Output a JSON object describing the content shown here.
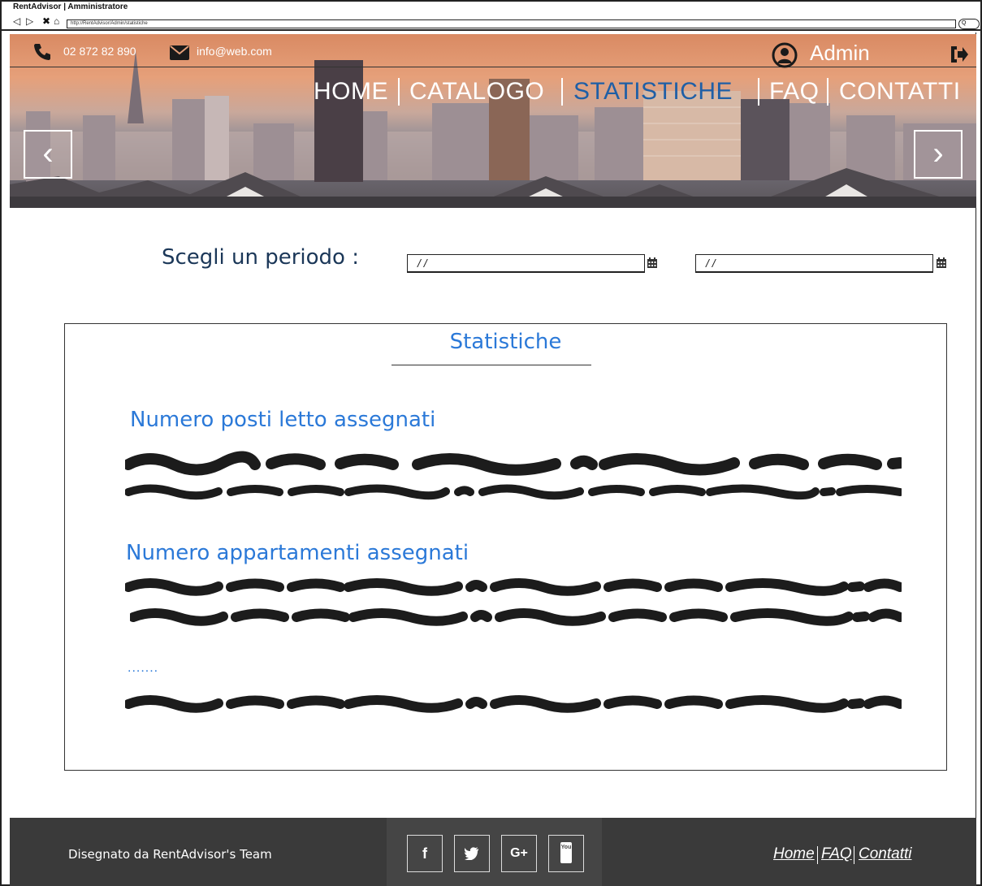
{
  "browser": {
    "window_title": "RentAdvisor | Amministratore",
    "url": "http://RentAdvisor/Admin/statistiche",
    "nav_back": "◁",
    "nav_forward": "▷",
    "nav_stop": "✖",
    "nav_home": "⌂",
    "search_glyph": "Q"
  },
  "header": {
    "phone": "02 872 82 890",
    "email": "info@web.com",
    "user_label": "Admin",
    "nav": [
      {
        "label": "HOME",
        "active": false
      },
      {
        "label": "CATALOGO",
        "active": false
      },
      {
        "label": "STATISTICHE",
        "active": true
      },
      {
        "label": "FAQ",
        "active": false
      },
      {
        "label": "CONTATTI",
        "active": false
      }
    ],
    "carousel_prev": "‹",
    "carousel_next": "›",
    "icons": {
      "phone": "phone-icon",
      "email": "envelope-icon",
      "user": "user-icon",
      "logout": "logout-icon",
      "calendar": "calendar-icon"
    }
  },
  "period": {
    "label": "Scegli un periodo :",
    "from_value": "/ /",
    "to_value": "/ /"
  },
  "stats": {
    "title": "Statistiche",
    "sections": [
      {
        "title": "Numero posti letto assegnati"
      },
      {
        "title": "Numero appartamenti assegnati"
      },
      {
        "title": "......."
      }
    ]
  },
  "footer": {
    "credit": "Disegnato da RentAdvisor's Team",
    "social": [
      {
        "name": "facebook",
        "glyph": "f"
      },
      {
        "name": "twitter",
        "glyph": "🐦"
      },
      {
        "name": "google-plus",
        "glyph": "G+"
      },
      {
        "name": "youtube",
        "glyph": "You"
      }
    ],
    "links": [
      "Home",
      "FAQ",
      "Contatti"
    ]
  },
  "colors": {
    "accent": "#2b79d8",
    "active_nav": "#1f5fa6",
    "footer_bg": "#3a3a3a",
    "label_dark": "#1b3758"
  }
}
